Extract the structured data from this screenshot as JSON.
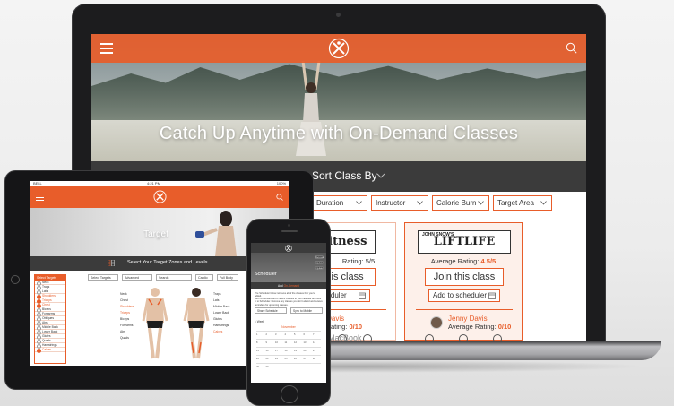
{
  "laptop": {
    "hero_title": "Catch Up Anytime with On-Demand Classes",
    "sort_label": "Sort Class By",
    "brand": "MacBook",
    "filters": [
      "Duration",
      "Instructor",
      "Calorie Burn",
      "Target Area"
    ],
    "cards": [
      {
        "logo": "inFitness",
        "rating_label": "Average Rating:",
        "rating_value": "5/5",
        "rating_visible": "Rating: 5/5",
        "join_label": "this class",
        "scheduler_label": "scheduler",
        "instructor_name": "nny Davis",
        "instructor_rating_label": "age Rating:",
        "instructor_rating_value": "0/10"
      },
      {
        "logo_small": "JOHN SNOW'S",
        "logo": "LIFTLIFE",
        "rating_label": "Average Rating:",
        "rating_value": "4.5/5",
        "join_label": "Join this class",
        "scheduler_label": "Add to scheduler",
        "instructor_name": "Jenny Davis",
        "instructor_rating_label": "Average Rating:",
        "instructor_rating_value": "0/10"
      }
    ]
  },
  "tablet": {
    "status_left": "BELL",
    "status_time": "4:21 PM",
    "status_right": "100%",
    "hero_title": "Target",
    "bar_label": "Select Your Target Zones and Levels",
    "filters": [
      "Select Targets",
      "Advanced",
      "Search",
      "Cardio",
      "Full Body"
    ],
    "list_title": "Select Targets",
    "list_items": [
      {
        "label": "Neck",
        "active": false
      },
      {
        "label": "Traps",
        "active": false
      },
      {
        "label": "Lats",
        "active": false
      },
      {
        "label": "Shoulders",
        "active": true
      },
      {
        "label": "Triceps",
        "active": true
      },
      {
        "label": "Chest",
        "active": true
      },
      {
        "label": "Biceps",
        "active": false
      },
      {
        "label": "Forearms",
        "active": false
      },
      {
        "label": "Obliques",
        "active": false
      },
      {
        "label": "Abs",
        "active": false
      },
      {
        "label": "Middle Back",
        "active": false
      },
      {
        "label": "Lower Back",
        "active": false
      },
      {
        "label": "Glutes",
        "active": false
      },
      {
        "label": "Quads",
        "active": false
      },
      {
        "label": "Hamstrings",
        "active": false
      },
      {
        "label": "Calves",
        "active": true
      }
    ],
    "body_labels_left": [
      {
        "label": "Neck",
        "on": false
      },
      {
        "label": "Chest",
        "on": false
      },
      {
        "label": "Shoulders",
        "on": true
      },
      {
        "label": "Triceps",
        "on": true
      },
      {
        "label": "Biceps",
        "on": false
      },
      {
        "label": "Forearms",
        "on": false
      },
      {
        "label": "Abs",
        "on": false
      },
      {
        "label": "Quads",
        "on": false
      }
    ],
    "body_labels_right": [
      {
        "label": "Traps",
        "on": false
      },
      {
        "label": "Lats",
        "on": false
      },
      {
        "label": "Middle Back",
        "on": false
      },
      {
        "label": "Lower Back",
        "on": false
      },
      {
        "label": "Glutes",
        "on": false
      },
      {
        "label": "Hamstrings",
        "on": false
      },
      {
        "label": "Calves",
        "on": true
      }
    ]
  },
  "phone": {
    "hero_title": "Scheduler",
    "hero_buttons": [
      "Remove",
      "Update",
      "Update"
    ],
    "bar_prefix": "Add",
    "bar_highlight": "On-Demand",
    "text_1": "The Scheduler below retrieves all of the classes that you've added.",
    "text_2": "Add On-Demand and Present Classes to your calendar and tune in to Scheduler. Remove any classes you don't attend and receive reminders for upcoming classes.",
    "share_label": "Share Schedule",
    "sync_label": "Sync to Mobile",
    "view_label": "< Week",
    "month_label": "November",
    "cal_rows": [
      [
        "1",
        "2",
        "3",
        "4",
        "5",
        "6",
        "7"
      ],
      [
        "8",
        "9",
        "10",
        "11",
        "12",
        "13",
        "14"
      ],
      [
        "15",
        "16",
        "17",
        "18",
        "19",
        "20",
        "21"
      ],
      [
        "22",
        "23",
        "24",
        "25",
        "26",
        "27",
        "28"
      ],
      [
        "29",
        "30",
        "",
        "",
        "",
        "",
        ""
      ]
    ]
  },
  "colors": {
    "accent": "#e85d2a",
    "dark_bar": "#3b3b3b",
    "device_frame": "#1c1c1e"
  },
  "icons": [
    "menu-icon",
    "logo-icon",
    "search-icon",
    "grid-view-icon",
    "list-view-icon",
    "chevron-down-icon",
    "calendar-icon"
  ]
}
